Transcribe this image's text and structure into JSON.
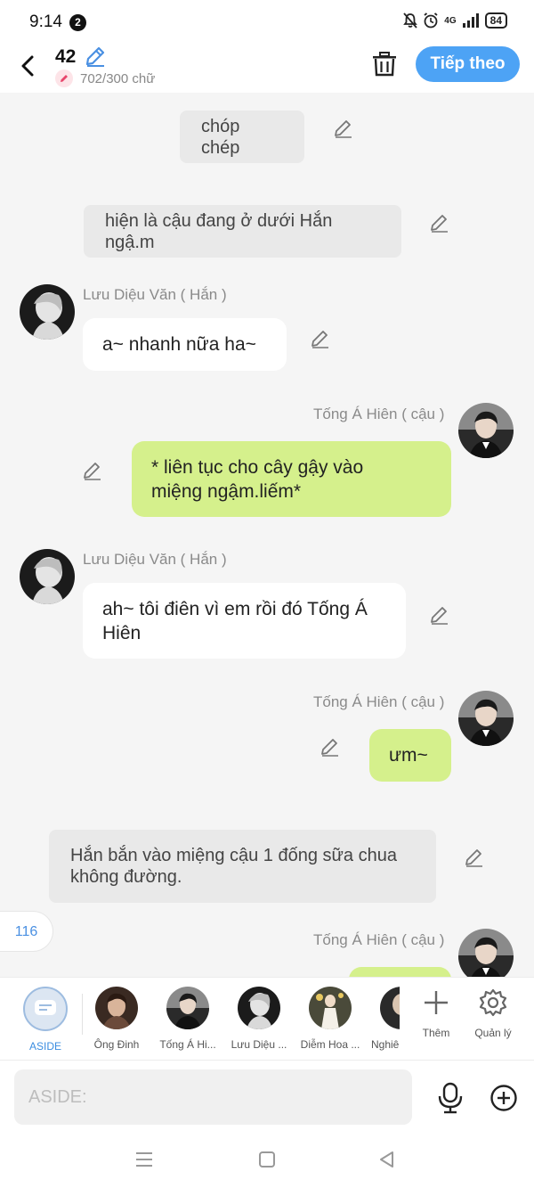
{
  "status_bar": {
    "time": "9:14",
    "notification_count": "2",
    "battery": "84",
    "network": "4G"
  },
  "header": {
    "title": "42",
    "word_count": "702/300 chữ",
    "next_label": "Tiếp theo"
  },
  "messages": {
    "narration_1": "chóp chép",
    "narration_2": "hiện là cậu đang ở dưới Hắn ngậ.m",
    "han_name": "Lưu Diệu Văn ( Hắn )",
    "cau_name": "Tống Á Hiên ( cậu )",
    "han_msg_1": "a~ nhanh nữa ha~",
    "cau_msg_1_line1": "* liên tục cho cây gậy vào",
    "cau_msg_1_line2": "miệng ngậm.liếm*",
    "han_msg_2_line1": "ah~ tôi điên vì em rồi đó Tống Á",
    "han_msg_2_line2": "Hiên",
    "cau_msg_2": "ưm~",
    "narration_3_line1": "Hắn bắn vào miệng cậu 1 đống sữa chua",
    "narration_3_line2": "không đường."
  },
  "unread_badge": "116",
  "characters": [
    {
      "name": "ASIDE"
    },
    {
      "name": "Ông Đinh"
    },
    {
      "name": "Tống Á Hi..."
    },
    {
      "name": "Lưu Diệu ..."
    },
    {
      "name": "Diễm Hoa ..."
    },
    {
      "name": "Nghiê"
    }
  ],
  "actions": {
    "add_label": "Thêm",
    "manage_label": "Quản lý"
  },
  "input": {
    "placeholder": "ASIDE:"
  },
  "colors": {
    "accent": "#4da3f5",
    "right_bubble": "#d5f08c",
    "left_bubble": "#ffffff",
    "narration_bg": "#e9e9e9"
  }
}
